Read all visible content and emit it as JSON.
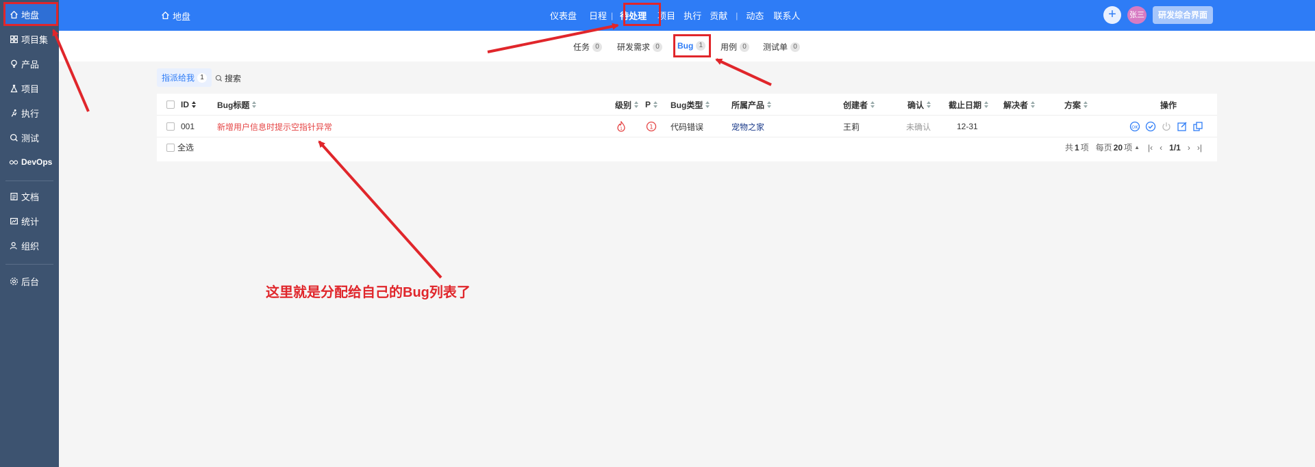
{
  "sidebar": {
    "items": [
      {
        "label": "地盘",
        "icon": "home-icon",
        "active": true
      },
      {
        "label": "项目集",
        "icon": "grid-icon"
      },
      {
        "label": "产品",
        "icon": "bulb-icon"
      },
      {
        "label": "项目",
        "icon": "flask-icon"
      },
      {
        "label": "执行",
        "icon": "run-icon"
      },
      {
        "label": "测试",
        "icon": "magnifier-icon"
      },
      {
        "label": "DevOps",
        "icon": "infinity-icon"
      },
      {
        "label": "文档",
        "icon": "document-icon"
      },
      {
        "label": "统计",
        "icon": "chart-icon"
      },
      {
        "label": "组织",
        "icon": "people-icon"
      },
      {
        "label": "后台",
        "icon": "gear-icon"
      }
    ]
  },
  "header": {
    "breadcrumb": "地盘",
    "nav": [
      "仪表盘",
      "日程",
      "待处理",
      "项目",
      "执行",
      "贡献",
      "动态",
      "联系人"
    ],
    "user_initials": "张三",
    "role_button": "研发综合界面"
  },
  "subnav": {
    "tabs": [
      {
        "label": "任务",
        "count": "0"
      },
      {
        "label": "研发需求",
        "count": "0"
      },
      {
        "label": "Bug",
        "count": "1",
        "active": true
      },
      {
        "label": "用例",
        "count": "0"
      },
      {
        "label": "测试单",
        "count": "0"
      }
    ]
  },
  "filter": {
    "assigned_label": "指派给我",
    "assigned_count": "1",
    "search_label": "搜索"
  },
  "table": {
    "columns": [
      "ID",
      "Bug标题",
      "级别",
      "P",
      "Bug类型",
      "所属产品",
      "创建者",
      "确认",
      "截止日期",
      "解决者",
      "方案",
      "操作"
    ],
    "rows": [
      {
        "id": "001",
        "title": "新增用户信息时提示空指针异常",
        "severity": "critical",
        "priority": "1",
        "type": "代码错误",
        "product": "宠物之家",
        "creator": "王莉",
        "confirmed": "未确认",
        "deadline": "12-31",
        "resolver": "",
        "resolution": ""
      }
    ],
    "select_all": "全选",
    "pager": {
      "total_prefix": "共",
      "total": "1",
      "total_suffix": "项",
      "per_page_prefix": "每页",
      "per_page": "20",
      "per_page_suffix": "项",
      "page": "1/1"
    }
  },
  "annotation": {
    "text": "这里就是分配给自己的Bug列表了",
    "color": "#e0262b"
  },
  "colors": {
    "primary": "#2e7cf6",
    "sidebar": "#3d5370",
    "annotation": "#e0262b",
    "bug_title": "#e54545"
  }
}
